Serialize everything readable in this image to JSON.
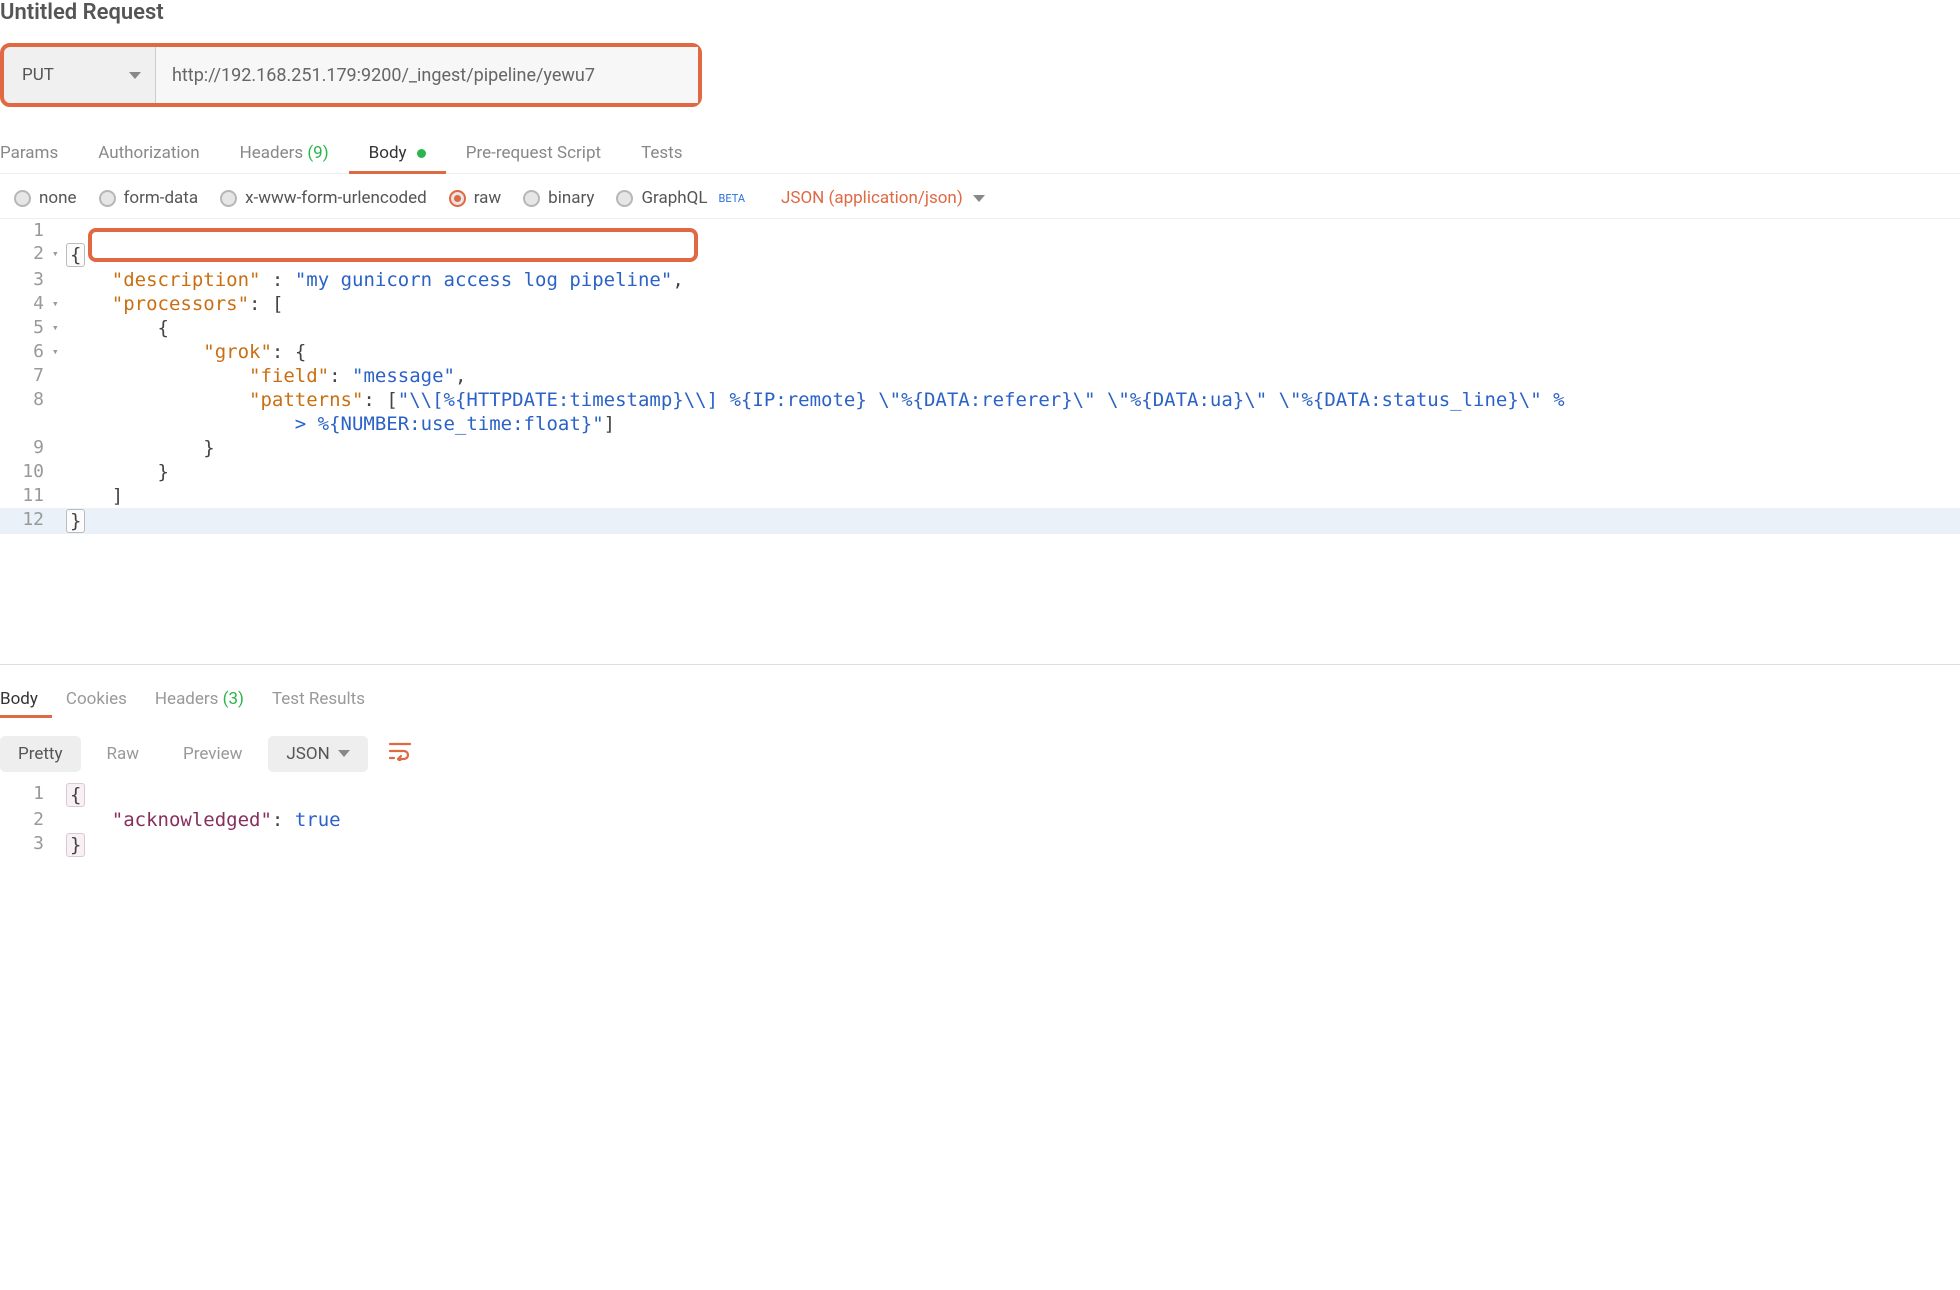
{
  "request": {
    "name": "Untitled Request",
    "method": "PUT",
    "url": "http://192.168.251.179:9200/_ingest/pipeline/yewu7"
  },
  "tabs": {
    "params": "Params",
    "authorization": "Authorization",
    "headers": "Headers",
    "headers_count": "(9)",
    "body": "Body",
    "prerequest": "Pre-request Script",
    "tests": "Tests"
  },
  "body_types": {
    "none": "none",
    "formdata": "form-data",
    "urlencoded": "x-www-form-urlencoded",
    "raw": "raw",
    "binary": "binary",
    "graphql": "GraphQL",
    "beta": "BETA",
    "content_type": "JSON (application/json)"
  },
  "body_lines": {
    "l1": "",
    "l2_open": "{",
    "l3_key": "\"description\"",
    "l3_sep": " : ",
    "l3_val": "\"my gunicorn access log pipeline\"",
    "l3_end": ",",
    "l4_key": "\"processors\"",
    "l4_sep": ": ",
    "l4_val": "[",
    "l5": "{",
    "l6_key": "\"grok\"",
    "l6_sep": ": ",
    "l6_val": "{",
    "l7_key": "\"field\"",
    "l7_sep": ": ",
    "l7_val": "\"message\"",
    "l7_end": ",",
    "l8_key": "\"patterns\"",
    "l8_sep": ": ",
    "l8_open": "[",
    "l8_val": "\"\\\\[%{HTTPDATE:timestamp}\\\\] %{IP:remote} \\\"%{DATA:referer}\\\" \\\"%{DATA:ua}\\\" \\\"%{DATA:status_line}\\\" %",
    "l8b_val": "> %{NUMBER:use_time:float}\"",
    "l8_close": "]",
    "l9": "}",
    "l10": "}",
    "l11": "]",
    "l12": "}",
    "ln": {
      "1": "1",
      "2": "2",
      "3": "3",
      "4": "4",
      "5": "5",
      "6": "6",
      "7": "7",
      "8": "8",
      "9": "9",
      "10": "10",
      "11": "11",
      "12": "12"
    }
  },
  "response": {
    "tabs": {
      "body": "Body",
      "cookies": "Cookies",
      "headers": "Headers",
      "headers_count": "(3)",
      "tests": "Test Results"
    },
    "toolbar": {
      "pretty": "Pretty",
      "raw": "Raw",
      "preview": "Preview",
      "format": "JSON"
    },
    "lines": {
      "ln": {
        "1": "1",
        "2": "2",
        "3": "3"
      },
      "l1": "{",
      "l2_key": "\"acknowledged\"",
      "l2_sep": ": ",
      "l2_val": "true",
      "l3": "}"
    }
  }
}
